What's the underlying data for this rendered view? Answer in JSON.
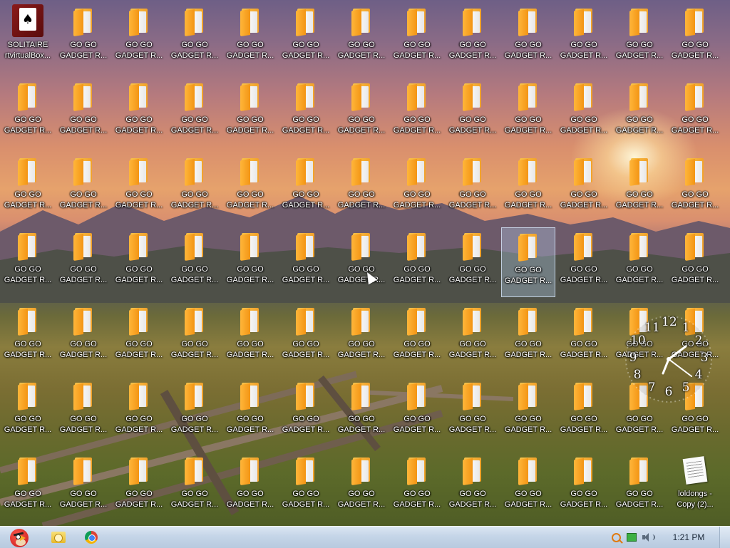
{
  "desktop": {
    "special_icons": [
      {
        "name": "solitaire",
        "label": "SOLITAIRE\nrtvirtualBox..."
      },
      {
        "name": "loldongs",
        "label": "loldongs -\nCopy (2)..."
      }
    ],
    "folder_label": "GO GO\nGADGET R...",
    "selected_folder_index": 47
  },
  "gadget_clock": {
    "numbers": [
      "12",
      "1",
      "2",
      "3",
      "4",
      "5",
      "6",
      "7",
      "8",
      "9",
      "10",
      "11"
    ]
  },
  "taskbar": {
    "start_icon": "angry-bird-icon",
    "pinned": [
      {
        "name": "explorer-icon"
      },
      {
        "name": "chrome-icon"
      }
    ],
    "tray_icons": [
      "search-icon",
      "battery-icon",
      "speaker-icon"
    ],
    "clock": "1:21 PM",
    "colors": {
      "bar": "#c5d5e8",
      "accent": "#e07a10"
    }
  }
}
